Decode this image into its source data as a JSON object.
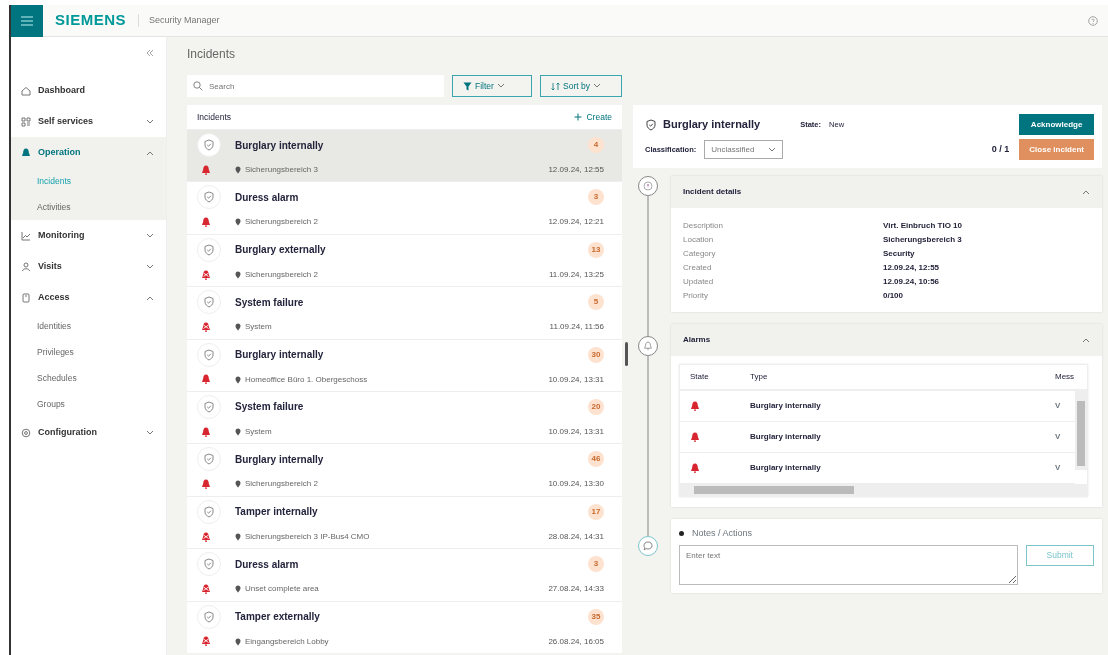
{
  "app": {
    "brand": "SIEMENS",
    "title": "Security Manager"
  },
  "sidebar": {
    "items": [
      {
        "kind": "link",
        "label": "Dashboard",
        "selected": false
      },
      {
        "kind": "group",
        "label": "Self services",
        "selected": false,
        "expanded": false
      },
      {
        "kind": "group",
        "label": "Operation",
        "selected": true,
        "expanded": true,
        "children": [
          {
            "label": "Incidents",
            "selected": true
          },
          {
            "label": "Activities",
            "selected": false
          }
        ]
      },
      {
        "kind": "group",
        "label": "Monitoring",
        "selected": false,
        "expanded": false
      },
      {
        "kind": "group",
        "label": "Visits",
        "selected": false,
        "expanded": false
      },
      {
        "kind": "group",
        "label": "Access",
        "selected": false,
        "expanded": true,
        "children": [
          {
            "label": "Identities",
            "selected": false
          },
          {
            "label": "Privileges",
            "selected": false
          },
          {
            "label": "Schedules",
            "selected": false
          },
          {
            "label": "Groups",
            "selected": false
          }
        ]
      },
      {
        "kind": "group",
        "label": "Configuration",
        "selected": false,
        "expanded": false
      }
    ]
  },
  "page_title": "Incidents",
  "search": {
    "placeholder": "Search"
  },
  "filter_button": "Filter",
  "sort_button": "Sort by",
  "incidents": {
    "title": "Incidents",
    "create": "Create",
    "rows": [
      {
        "title": "Burglary internally",
        "location": "Sicherungsbereich 3",
        "time": "12.09.24, 12:55",
        "count": "4",
        "alarm_reset": false,
        "selected": true
      },
      {
        "title": "Duress alarm",
        "location": "Sicherungsbereich 2",
        "time": "12.09.24, 12:21",
        "count": "3",
        "alarm_reset": false,
        "selected": false
      },
      {
        "title": "Burglary externally",
        "location": "Sicherungsbereich 2",
        "time": "11.09.24, 13:25",
        "count": "13",
        "alarm_reset": true,
        "selected": false
      },
      {
        "title": "System failure",
        "location": "System",
        "time": "11.09.24, 11:56",
        "count": "5",
        "alarm_reset": true,
        "selected": false
      },
      {
        "title": "Burglary internally",
        "location": "Homeoffice Büro 1. Obergeschoss",
        "time": "10.09.24, 13:31",
        "count": "30",
        "alarm_reset": false,
        "selected": false
      },
      {
        "title": "System failure",
        "location": "System",
        "time": "10.09.24, 13:31",
        "count": "20",
        "alarm_reset": false,
        "selected": false
      },
      {
        "title": "Burglary internally",
        "location": "Sicherungsbereich 2",
        "time": "10.09.24, 13:30",
        "count": "46",
        "alarm_reset": false,
        "selected": false
      },
      {
        "title": "Tamper internally",
        "location": "Sicherungsbereich 3 IP-Bus4 CMO",
        "time": "28.08.24, 14:31",
        "count": "17",
        "alarm_reset": true,
        "selected": false
      },
      {
        "title": "Duress alarm",
        "location": "Unset complete area",
        "time": "27.08.24, 14:33",
        "count": "3",
        "alarm_reset": true,
        "selected": false
      },
      {
        "title": "Tamper externally",
        "location": "Eingangsbereich Lobby",
        "time": "26.08.24, 16:05",
        "count": "35",
        "alarm_reset": true,
        "selected": false
      }
    ]
  },
  "detail": {
    "title": "Burglary internally",
    "state_label": "State:",
    "state": "New",
    "classification_label": "Classification:",
    "classification": "Unclassified",
    "progress": "0 / 1",
    "acknowledge": "Acknowledge",
    "close": "Close incident",
    "details": {
      "title": "Incident details",
      "expanded": true,
      "fields": [
        {
          "label": "Description",
          "value": "Virt. Einbruch TIO 10"
        },
        {
          "label": "Location",
          "value": "Sicherungsbereich 3"
        },
        {
          "label": "Category",
          "value": "Security"
        },
        {
          "label": "Created",
          "value": "12.09.24, 12:55"
        },
        {
          "label": "Updated",
          "value": "12.09.24, 10:56"
        },
        {
          "label": "Priority",
          "value": "0/100"
        }
      ]
    },
    "alarms": {
      "title": "Alarms",
      "expanded": true,
      "columns": [
        "State",
        "Type",
        "Mess"
      ],
      "rows": [
        {
          "alarm_reset": false,
          "type": "Burglary internally",
          "message": "V"
        },
        {
          "alarm_reset": false,
          "type": "Burglary internally",
          "message": "V"
        },
        {
          "alarm_reset": false,
          "type": "Burglary internally",
          "message": "V"
        }
      ]
    },
    "notes": {
      "title": "Notes / Actions",
      "placeholder": "Enter text",
      "submit": "Submit"
    }
  }
}
